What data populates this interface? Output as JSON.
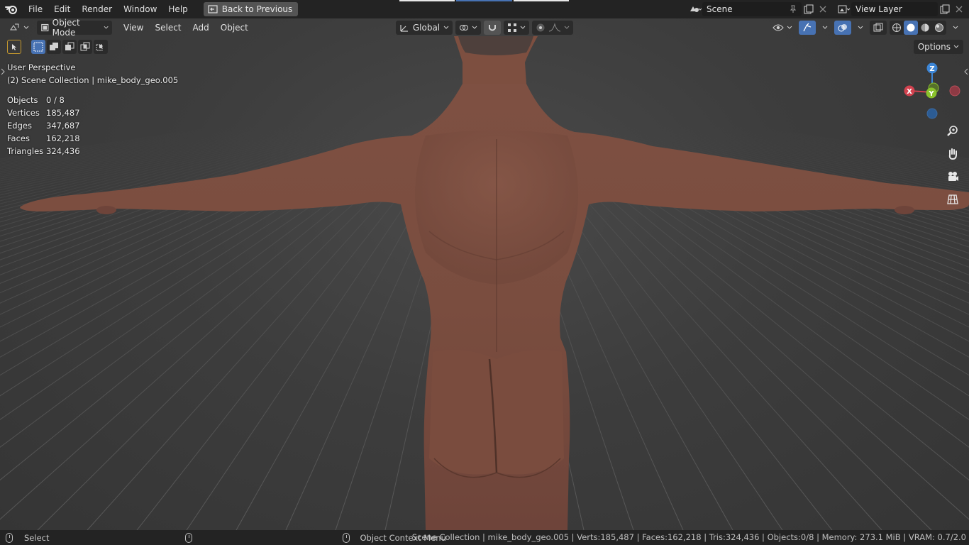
{
  "menu": {
    "items": [
      "File",
      "Edit",
      "Render",
      "Window",
      "Help"
    ],
    "back_button": "Back to Previous"
  },
  "scene": {
    "name": "Scene",
    "view_layer": "View Layer"
  },
  "viewport_header": {
    "mode": "Object Mode",
    "menus": [
      "View",
      "Select",
      "Add",
      "Object"
    ],
    "orientation": "Global",
    "options": "Options"
  },
  "overlay": {
    "perspective": "User Perspective",
    "collection": "(2) Scene Collection | mike_body_geo.005"
  },
  "stats": [
    {
      "label": "Objects",
      "value": "0 / 8"
    },
    {
      "label": "Vertices",
      "value": "185,487"
    },
    {
      "label": "Edges",
      "value": "347,687"
    },
    {
      "label": "Faces",
      "value": "162,218"
    },
    {
      "label": "Triangles",
      "value": "324,436"
    }
  ],
  "gizmo": {
    "x": "X",
    "y": "Y",
    "z": "Z"
  },
  "statusbar": {
    "select": "Select",
    "context_menu": "Object Context Menu",
    "info": "Scene Collection | mike_body_geo.005 | Verts:185,487 | Faces:162,218 | Tris:324,436 | Objects:0/8 | Memory: 273.1 MiB | VRAM: 0.7/2.0"
  },
  "colors": {
    "accent": "#4772b3",
    "skin": "#7d4f40",
    "x_axis": "#d2424f",
    "y_axis": "#8ac22c",
    "z_axis": "#3d86d6"
  }
}
